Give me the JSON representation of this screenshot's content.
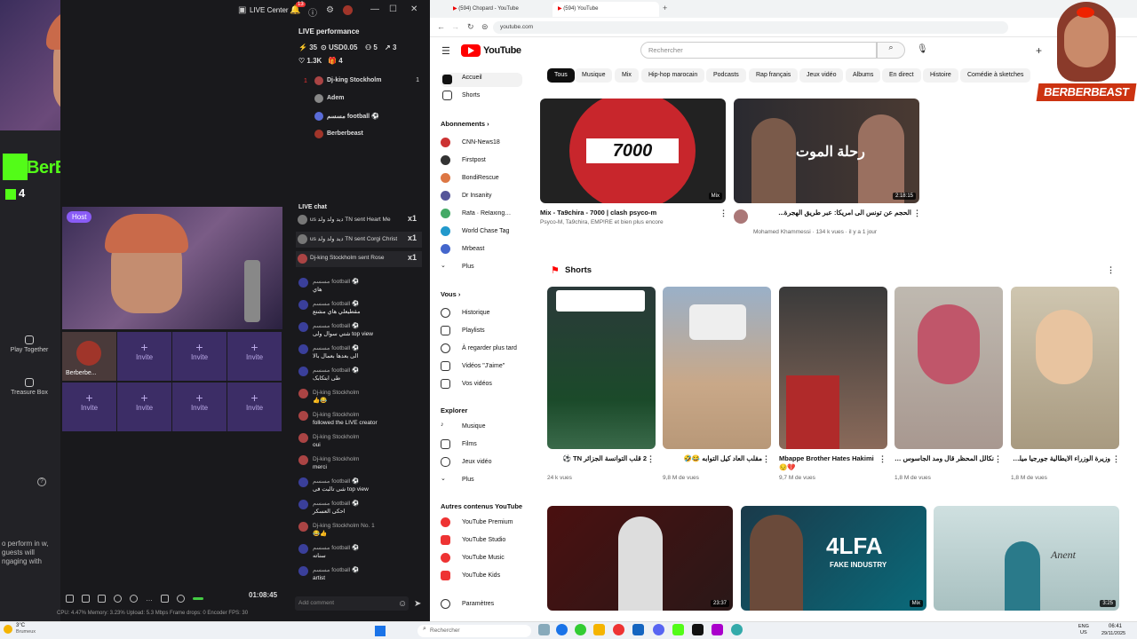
{
  "overlay": {
    "kick_channel": "BerBerBeast",
    "kick_viewers": "4",
    "side_buttons": [
      "Play Together",
      "Treasure Box"
    ],
    "perform_text": "o perform in w, guests will ngaging with"
  },
  "live_center": {
    "title": "LIVE Center",
    "notif_count": "13",
    "perf_title": "LIVE performance",
    "stats": {
      "coins": "35",
      "usd": "USD0.05",
      "people": "5",
      "shares": "3",
      "likes": "1.3K",
      "gifts": "4"
    },
    "ranking": [
      {
        "rank": "1",
        "name": "Dj-king Stockholm",
        "count": "1"
      },
      {
        "rank": "",
        "name": "Adem",
        "count": ""
      },
      {
        "rank": "",
        "name": "مسسم football ⚽",
        "count": ""
      },
      {
        "rank": "",
        "name": "Berberbeast",
        "count": ""
      }
    ],
    "host_label": "Host",
    "guest_name": "Berberbe...",
    "invite": "Invite",
    "chat_title": "LIVE chat",
    "gifts": [
      {
        "text": "us ديد ولد ولد TN sent Heart Me",
        "count": "x1"
      },
      {
        "text": "us ديد ولد ولد TN sent Corgi Christ",
        "count": "x1"
      },
      {
        "text": "Dj-king Stockholm sent Rose",
        "count": "x1"
      }
    ],
    "messages": [
      {
        "user": "مسسم football ⚽",
        "text": "هاي"
      },
      {
        "user": "مسسم football ⚽",
        "text": "مقطيعلي هاي مشتع"
      },
      {
        "user": "مسسم football ⚽",
        "text": "شتي سوال ولی top view"
      },
      {
        "user": "مسسم football ⚽",
        "text": "الی بعدها بعمال بالا"
      },
      {
        "user": "مسسم football ⚽",
        "text": "طی ابتکابک"
      },
      {
        "user": "Dj-king Stockholm",
        "text": "👍😂"
      },
      {
        "user": "Dj-king Stockholm",
        "text": "followed the LIVE creator"
      },
      {
        "user": "Dj-king Stockholm",
        "text": "oui"
      },
      {
        "user": "Dj-king Stockholm",
        "text": "merci"
      },
      {
        "user": "مسسم football ⚽",
        "text": "شی تالبت فی top view"
      },
      {
        "user": "مسسم football ⚽",
        "text": "احکی العسکر"
      },
      {
        "user": "Dj-king Stockholm No. 1",
        "text": "😂👍"
      },
      {
        "user": "مسسم football ⚽",
        "text": "سناته"
      },
      {
        "user": "مسسم football ⚽",
        "text": "artist"
      }
    ],
    "comment_placeholder": "Add comment",
    "timer": "01:08:45",
    "footer_stats": "CPU: 4.47%   Memory: 3.23%   Upload: 5.3 Mbps   Frame drops: 0   Encoder FPS: 30"
  },
  "browser": {
    "tabs": [
      "(594) Chopard - YouTube",
      "(594) YouTube"
    ],
    "url": "youtube.com"
  },
  "youtube": {
    "brand": "YouTube",
    "search_placeholder": "Rechercher",
    "chips": [
      "Tous",
      "Musique",
      "Mix",
      "Hip-hop marocain",
      "Podcasts",
      "Rap français",
      "Jeux vidéo",
      "Albums",
      "En direct",
      "Histoire",
      "Comédie à sketches"
    ],
    "nav": [
      "Accueil",
      "Shorts"
    ],
    "subs_title": "Abonnements",
    "subs": [
      "CNN-News18",
      "Firstpost",
      "BondiRescue",
      "Dr Insanity",
      "Rafa · Relaxing N...",
      "World Chase Tag",
      "Mrbeast",
      "Plus"
    ],
    "you_title": "Vous",
    "you": [
      "Historique",
      "Playlists",
      "À regarder plus tard",
      "Vidéos \"J'aime\"",
      "Vos vidéos"
    ],
    "explore_title": "Explorer",
    "explore": [
      "Musique",
      "Films",
      "Jeux vidéo",
      "Plus"
    ],
    "other_title": "Autres contenus YouTube",
    "other": [
      "YouTube Premium",
      "YouTube Studio",
      "YouTube Music",
      "YouTube Kids"
    ],
    "settings": "Paramètres",
    "videos": [
      {
        "title": "Mix - Ta9chira - 7000 | clash psyco-m",
        "meta": "Psyco-M, Ta9chira, EMP!RE et bien plus encore",
        "badge": "Mix",
        "thumb_text": "7000"
      },
      {
        "title": "الحجم عن تونس الى امريكا: عبر طريق الهجرة...",
        "meta": "Mohamed Khammessi · 134 k vues · il y a 1 jour",
        "badge": "2:18:15",
        "thumb_text": "رحلة الموت"
      }
    ],
    "shorts_title": "Shorts",
    "shorts": [
      {
        "title": "2 قلب التوانسة الجزائر TN ⚽",
        "meta": "24 k vues"
      },
      {
        "title": "مقلب العاد كيل التوابه 😂🤣",
        "meta": "9,8 M de vues"
      },
      {
        "title": "Mbappe Brother Hates Hakimi 😔💔",
        "meta": "9,7 M de vues"
      },
      {
        "title": "نكالل المحظر قال ومد الجاسوس 😂❌",
        "meta": "1,8 M de vues"
      },
      {
        "title": "وزيرة الوزراء الايطالية جورجيا ميلوني",
        "meta": "1,8 M de vues"
      }
    ],
    "bottom_videos": [
      {
        "badge": "23:37"
      },
      {
        "badge": "Mix",
        "thumb_text": "4LFA",
        "sub_text": "FAKE INDUSTRY"
      },
      {
        "badge": "3:25",
        "thumb_text": "Anent"
      }
    ]
  },
  "taskbar": {
    "weather": "3°C",
    "weather_sub": "Brumeux",
    "search": "Rechercher",
    "lang": "ENG",
    "lang_sub": "US",
    "time": "06:41",
    "date": "29/11/2025"
  },
  "logo": {
    "text": "BERBERBEAST"
  }
}
